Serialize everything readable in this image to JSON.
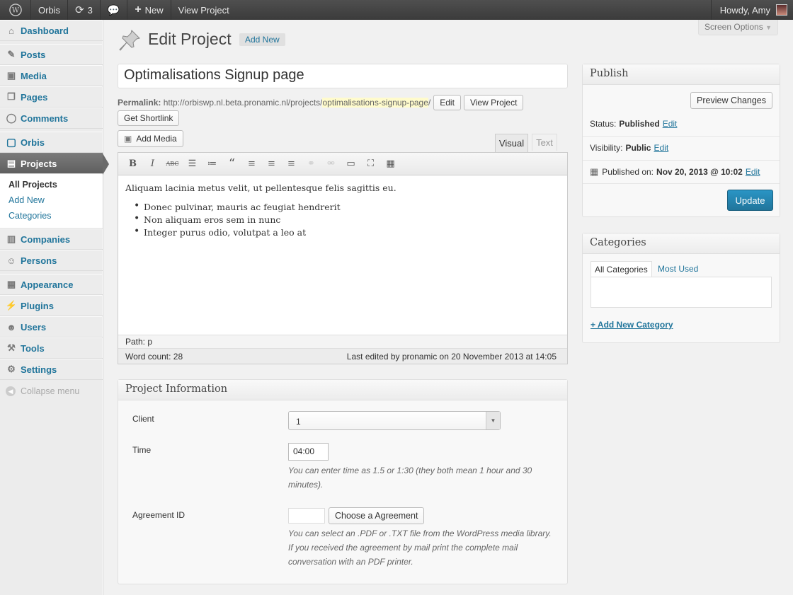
{
  "adminbar": {
    "site_name": "Orbis",
    "updates_count": "3",
    "new_label": "New",
    "view_project": "View Project",
    "howdy": "Howdy, Amy"
  },
  "sidebar": {
    "items": [
      {
        "label": "Dashboard"
      },
      {
        "label": "Posts"
      },
      {
        "label": "Media"
      },
      {
        "label": "Pages"
      },
      {
        "label": "Comments"
      },
      {
        "label": "Orbis"
      },
      {
        "label": "Projects"
      },
      {
        "label": "Companies"
      },
      {
        "label": "Persons"
      },
      {
        "label": "Appearance"
      },
      {
        "label": "Plugins"
      },
      {
        "label": "Users"
      },
      {
        "label": "Tools"
      },
      {
        "label": "Settings"
      }
    ],
    "submenu": [
      "All Projects",
      "Add New",
      "Categories"
    ],
    "collapse": "Collapse menu"
  },
  "header": {
    "title": "Edit Project",
    "add_new": "Add New",
    "screen_options": "Screen Options"
  },
  "post": {
    "title": "Optimalisations Signup page",
    "permalink_label": "Permalink:",
    "permalink_base": "http://orbiswp.nl.beta.pronamic.nl/projects/",
    "permalink_slug": "optimalisations-signup-page",
    "permalink_tail": "/",
    "edit_btn": "Edit",
    "view_btn": "View Project",
    "shortlink_btn": "Get Shortlink",
    "add_media": "Add Media"
  },
  "editor": {
    "tab_visual": "Visual",
    "tab_text": "Text",
    "paragraph": "Aliquam lacinia metus velit, ut pellentesque felis sagittis eu.",
    "bullets": [
      "Donec pulvinar, mauris ac feugiat hendrerit",
      "Non aliquam eros sem in nunc",
      "Integer purus odio, volutpat a leo at"
    ],
    "path": "Path: p",
    "word_count": "Word count: 28",
    "last_edited": "Last edited by pronamic on 20 November 2013 at 14:05"
  },
  "project_info": {
    "title": "Project Information",
    "client_label": "Client",
    "client_value": "1",
    "time_label": "Time",
    "time_value": "04:00",
    "time_desc": "You can enter time as 1.5 or 1:30 (they both mean 1 hour and 30 minutes).",
    "agreement_label": "Agreement ID",
    "agreement_btn": "Choose a Agreement",
    "agreement_desc": "You can select an .PDF or .TXT file from the WordPress media library. If you received the agreement by mail print the complete mail conversation with an PDF printer."
  },
  "publish": {
    "title": "Publish",
    "preview": "Preview Changes",
    "status_label": "Status:",
    "status_value": "Published",
    "visibility_label": "Visibility:",
    "visibility_value": "Public",
    "published_label": "Published on:",
    "published_value": "Nov 20, 2013 @ 10:02",
    "edit_link": "Edit",
    "update": "Update"
  },
  "categories": {
    "title": "Categories",
    "tab_all": "All Categories",
    "tab_used": "Most Used",
    "add_new": "+ Add New Category"
  },
  "colors": {
    "link": "#21759b",
    "adminbar": "#464646",
    "primary_button": "#21759b"
  }
}
